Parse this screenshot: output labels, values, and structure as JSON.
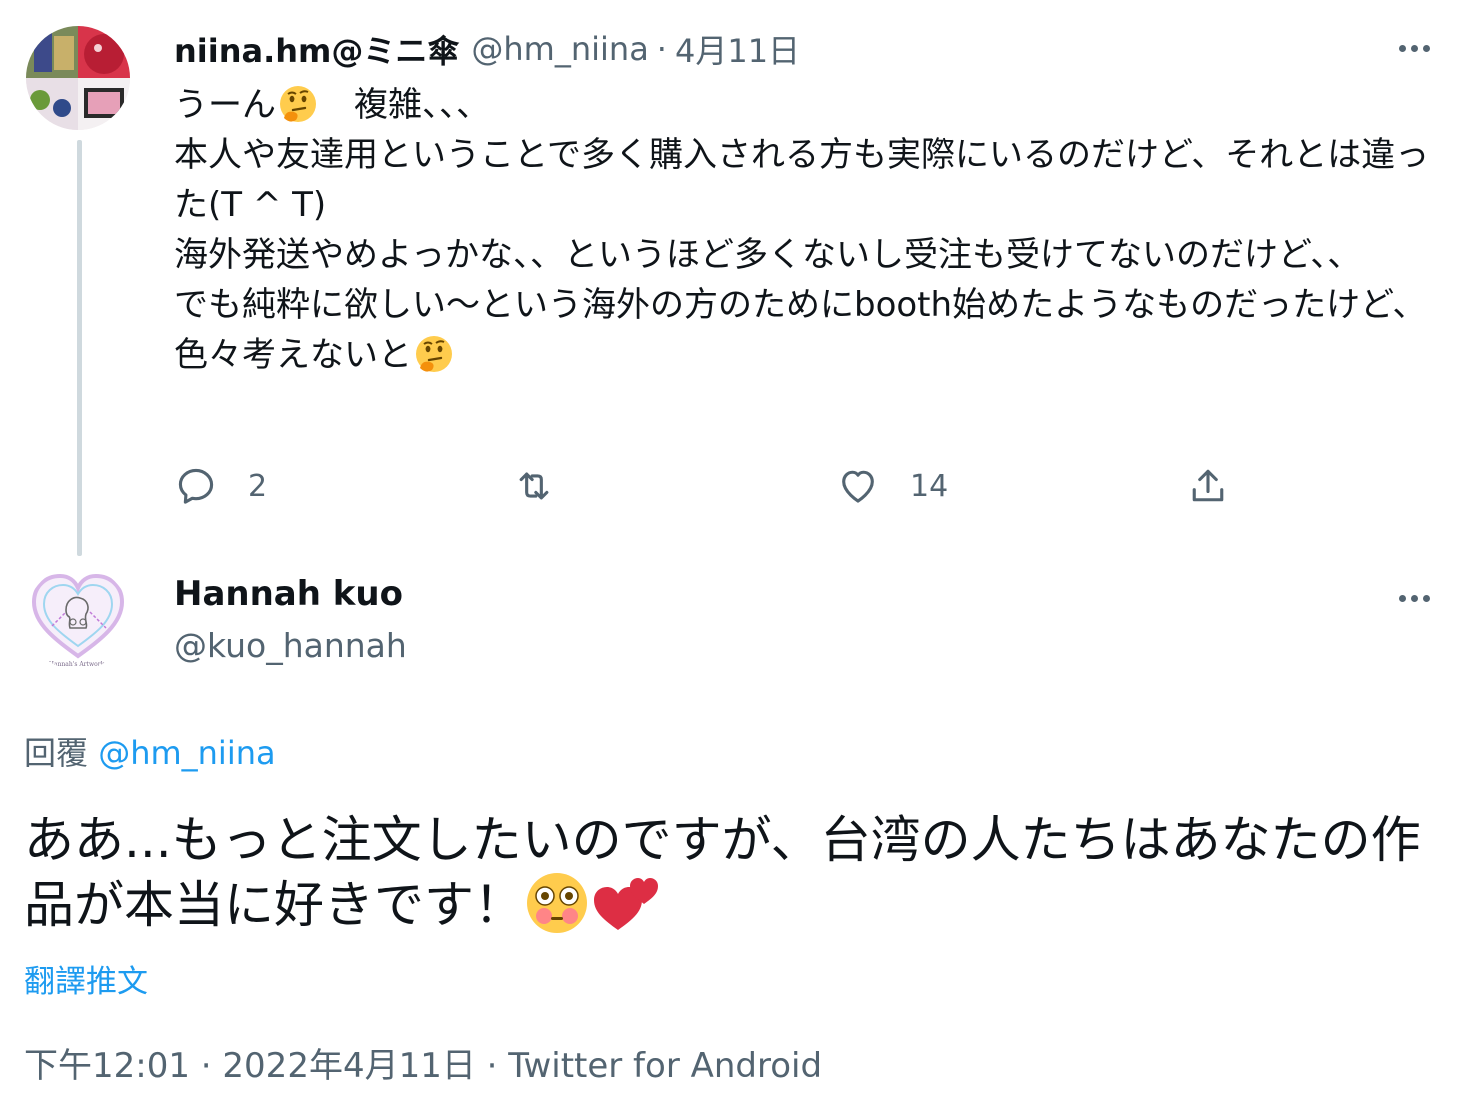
{
  "tweet1": {
    "display_name": "niina.hm@ミニ傘",
    "handle": "@hm_niina",
    "separator": "·",
    "date": "4月11日",
    "lines": [
      {
        "text": "うーん",
        "after_emoji": "　複雑、、、"
      },
      {
        "text": "本人や友達用ということで多く購入される方も実際にいるのだけど、それとは違った(T ^ T)"
      },
      {
        "text": "海外発送やめよっかな、、というほど多くないし受注も受けてないのだけど、、"
      },
      {
        "text": "でも純粋に欲しい〜という海外の方のためにbooth始めたようなものだったけど、色々考えないと"
      }
    ],
    "emoji": "thinking-face-emoji",
    "actions": {
      "reply_count": "2",
      "retweet_count": "",
      "like_count": "14"
    }
  },
  "tweet2": {
    "display_name": "Hannah kuo",
    "handle": "@kuo_hannah",
    "reply_prefix": "回覆",
    "reply_mention": "@hm_niina",
    "body": "ああ...もっと注文したいのですが、台湾の人たちはあなたの作品が本当に好きです！",
    "emojis": [
      "flushed-face-emoji",
      "two-hearts-emoji"
    ],
    "translate_label": "翻譯推文",
    "time": "下午12:01",
    "separator": "·",
    "date": "2022年4月11日",
    "source": "Twitter for Android",
    "avatar_text": "Hannah's Artworks"
  },
  "colors": {
    "text": "#0f1419",
    "muted": "#536471",
    "link": "#1d9bf0",
    "thread_line": "#cfd9de"
  }
}
